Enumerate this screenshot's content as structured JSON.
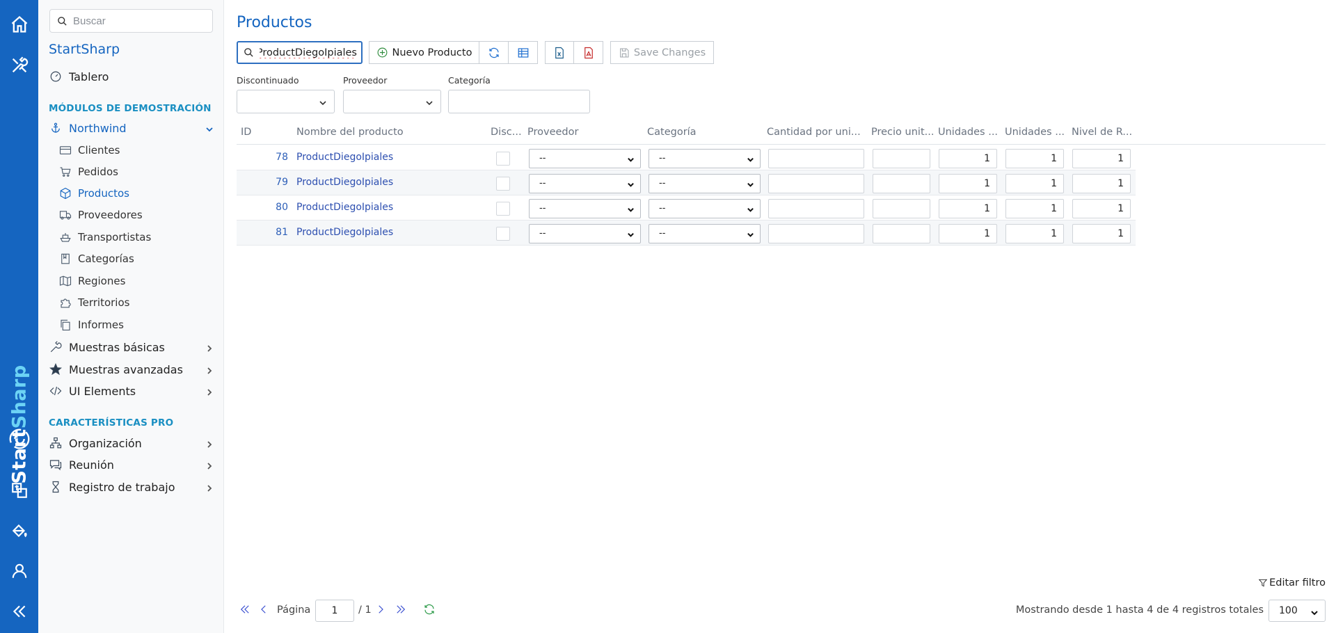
{
  "sidebar": {
    "search_placeholder": "Buscar",
    "brand": "StartSharp",
    "dashboard": "Tablero",
    "section_demo": "MÓDULOS DE DEMOSTRACIÓN",
    "northwind": "Northwind",
    "northwind_items": [
      "Clientes",
      "Pedidos",
      "Productos",
      "Proveedores",
      "Transportistas",
      "Categorías",
      "Regiones",
      "Territorios",
      "Informes"
    ],
    "basic_samples": "Muestras básicas",
    "advanced_samples": "Muestras avanzadas",
    "ui_elements": "UI Elements",
    "section_pro": "CARACTERÍSTICAS PRO",
    "organization": "Organización",
    "meeting": "Reunión",
    "work_log": "Registro de trabajo"
  },
  "rail": {
    "brand_start": "Start",
    "brand_sharp": "Sharp"
  },
  "main": {
    "title": "Productos",
    "quick_search_value": "ProductDiegoIpiales",
    "new_button": "Nuevo Producto",
    "save_button": "Save Changes",
    "filters": {
      "discontinued": "Discontinuado",
      "supplier": "Proveedor",
      "category": "Categoría"
    },
    "columns": [
      "ID",
      "Nombre del producto",
      "Disc...",
      "Proveedor",
      "Categoría",
      "Cantidad por uni...",
      "Precio unit...",
      "Unidades ...",
      "Unidades ...",
      "Nivel de R..."
    ],
    "rows": [
      {
        "id": "78",
        "name": "ProductDiegoIpiales",
        "supplier": "--",
        "category": "--",
        "u1": "1",
        "u2": "1",
        "reorder": "1"
      },
      {
        "id": "79",
        "name": "ProductDiegoIpiales",
        "supplier": "--",
        "category": "--",
        "u1": "1",
        "u2": "1",
        "reorder": "1"
      },
      {
        "id": "80",
        "name": "ProductDiegoIpiales",
        "supplier": "--",
        "category": "--",
        "u1": "1",
        "u2": "1",
        "reorder": "1"
      },
      {
        "id": "81",
        "name": "ProductDiegoIpiales",
        "supplier": "--",
        "category": "--",
        "u1": "1",
        "u2": "1",
        "reorder": "1"
      }
    ],
    "edit_filter": "Editar filtro",
    "pager": {
      "page_label": "Página",
      "page": "1",
      "total": "/ 1",
      "info": "Mostrando desde 1 hasta 4 de 4 registros totales",
      "page_size": "100"
    }
  },
  "colors": {
    "primary": "#1565c0",
    "section": "#1a8fc2"
  }
}
